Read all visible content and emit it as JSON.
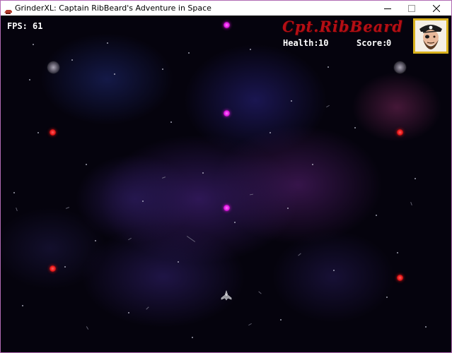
{
  "window": {
    "title": "GrinderXL: Captain RibBeard's Adventure in Space",
    "controls": {
      "minimize_icon": "minimize-icon",
      "maximize_icon": "maximize-icon",
      "close_icon": "close-icon"
    }
  },
  "hud": {
    "fps_label": "FPS:",
    "fps_value": "61",
    "health_label": "Health:",
    "health_value": "10",
    "score_label": "Score:",
    "score_value": "0",
    "logo_text": "Cpt.RibBeard"
  },
  "colors": {
    "hud_text": "#ffffff",
    "logo": "#b40e14",
    "portrait_frame": "#d9b21e",
    "magenta_orb": "#e214e4",
    "red_orb": "#e81515",
    "space_background": "#05030d"
  }
}
